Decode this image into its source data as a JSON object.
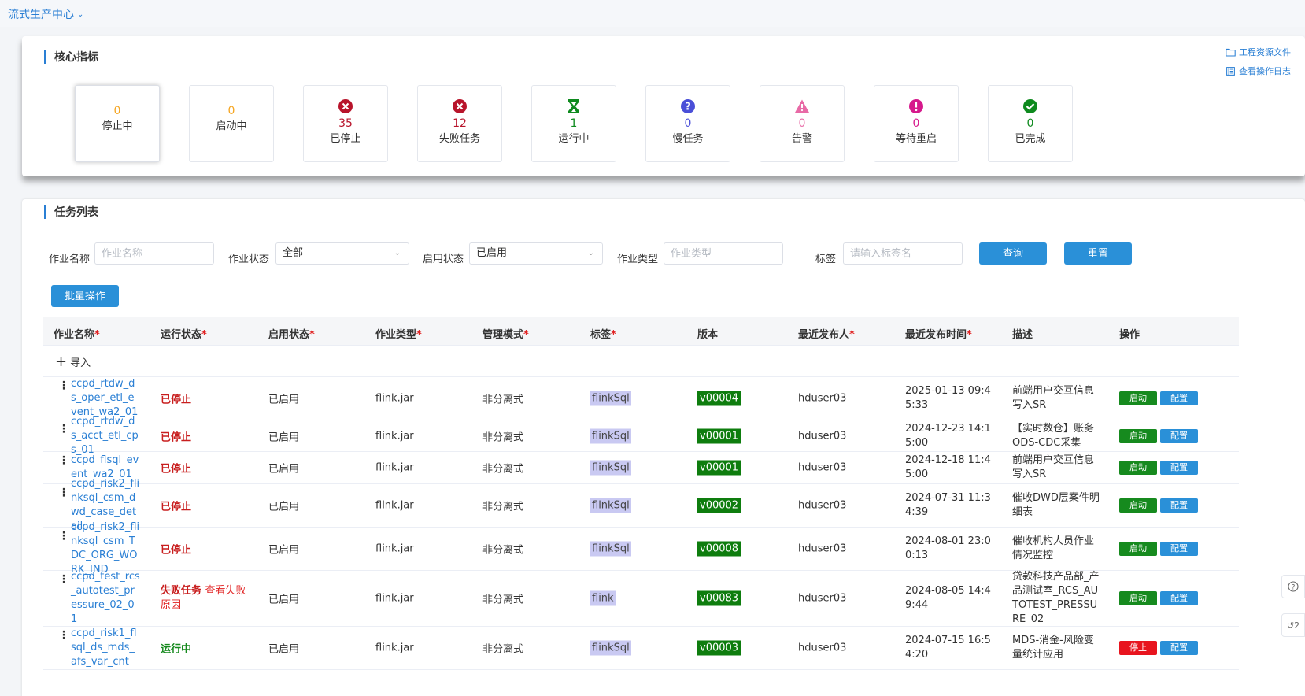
{
  "topbar": {
    "title": "流式生产中心"
  },
  "core": {
    "title": "核心指标",
    "links": [
      {
        "label": "工程资源文件",
        "icon": "folder-icon"
      },
      {
        "label": "查看操作日志",
        "icon": "log-icon"
      }
    ],
    "metrics": [
      {
        "value": "0",
        "label": "停止中",
        "color": "#f5a623",
        "icon": "none"
      },
      {
        "value": "0",
        "label": "启动中",
        "color": "#f5a623",
        "icon": "none"
      },
      {
        "value": "35",
        "label": "已停止",
        "color": "#b8142b",
        "icon": "x-circle-icon"
      },
      {
        "value": "12",
        "label": "失败任务",
        "color": "#b8142b",
        "icon": "x-circle-icon"
      },
      {
        "value": "1",
        "label": "运行中",
        "color": "#0e8a1e",
        "icon": "hourglass-icon"
      },
      {
        "value": "0",
        "label": "慢任务",
        "color": "#4a4fd8",
        "icon": "question-circle-icon"
      },
      {
        "value": "0",
        "label": "告警",
        "color": "#e86aa6",
        "icon": "warning-triangle-icon"
      },
      {
        "value": "0",
        "label": "等待重启",
        "color": "#d6198c",
        "icon": "exclamation-circle-icon"
      },
      {
        "value": "0",
        "label": "已完成",
        "color": "#0e8a1e",
        "icon": "check-circle-icon"
      }
    ]
  },
  "tasks": {
    "title": "任务列表",
    "filters": {
      "job_name_label": "作业名称",
      "job_name_placeholder": "作业名称",
      "run_status_label": "作业状态",
      "run_status_value": "全部",
      "enable_status_label": "启用状态",
      "enable_status_value": "已启用",
      "job_type_label": "作业类型",
      "job_type_placeholder": "作业类型",
      "tag_label": "标签",
      "tag_placeholder": "请输入标签名",
      "query_label": "查询",
      "reset_label": "重置"
    },
    "batch_label": "批量操作",
    "import_label": "导入",
    "columns": [
      {
        "label": "作业名称",
        "req": "*"
      },
      {
        "label": "运行状态",
        "req": "*"
      },
      {
        "label": "启用状态",
        "req": "*"
      },
      {
        "label": "作业类型",
        "req": "*"
      },
      {
        "label": "管理模式",
        "req": "*"
      },
      {
        "label": "标签",
        "req": "*"
      },
      {
        "label": "版本",
        "req": ""
      },
      {
        "label": "最近发布人",
        "req": "*"
      },
      {
        "label": "最近发布时间",
        "req": "*"
      },
      {
        "label": "描述",
        "req": ""
      },
      {
        "label": "操作",
        "req": ""
      }
    ],
    "rows": [
      {
        "name": "ccpd_rtdw_ds_oper_etl_event_wa2_01",
        "status": "已停止",
        "status_type": "stop",
        "fail_link": "",
        "enabled": "已启用",
        "type": "flink.jar",
        "mode": "非分离式",
        "tag": "flinkSql",
        "version": "v00004",
        "publisher": "hduser03",
        "time": "2025-01-13 09:45:33",
        "desc": "前端用户交互信息写入SR",
        "action": "启动",
        "action_type": "start",
        "config": "配置"
      },
      {
        "name": "ccpd_rtdw_ds_acct_etl_cps_01",
        "status": "已停止",
        "status_type": "stop",
        "fail_link": "",
        "enabled": "已启用",
        "type": "flink.jar",
        "mode": "非分离式",
        "tag": "flinkSql",
        "version": "v00001",
        "publisher": "hduser03",
        "time": "2024-12-23 14:15:00",
        "desc": "【实时数仓】账务ODS-CDC采集",
        "action": "启动",
        "action_type": "start",
        "config": "配置"
      },
      {
        "name": "ccpd_flsql_event_wa2_01",
        "status": "已停止",
        "status_type": "stop",
        "fail_link": "",
        "enabled": "已启用",
        "type": "flink.jar",
        "mode": "非分离式",
        "tag": "flinkSql",
        "version": "v00001",
        "publisher": "hduser03",
        "time": "2024-12-18 11:45:00",
        "desc": "前端用户交互信息写入SR",
        "action": "启动",
        "action_type": "start",
        "config": "配置"
      },
      {
        "name": "ccpd_risk2_flinksql_csm_dwd_case_detail",
        "status": "已停止",
        "status_type": "stop",
        "fail_link": "",
        "enabled": "已启用",
        "type": "flink.jar",
        "mode": "非分离式",
        "tag": "flinkSql",
        "version": "v00002",
        "publisher": "hduser03",
        "time": "2024-07-31 11:34:39",
        "desc": "催收DWD层案件明细表",
        "action": "启动",
        "action_type": "start",
        "config": "配置"
      },
      {
        "name": "ccpd_risk2_flinksql_csm_TDC_ORG_WORK_IND",
        "status": "已停止",
        "status_type": "stop",
        "fail_link": "",
        "enabled": "已启用",
        "type": "flink.jar",
        "mode": "非分离式",
        "tag": "flinkSql",
        "version": "v00008",
        "publisher": "hduser03",
        "time": "2024-08-01 23:00:13",
        "desc": "催收机构人员作业情况监控",
        "action": "启动",
        "action_type": "start",
        "config": "配置"
      },
      {
        "name": "ccpd_test_rcs_autotest_pressure_02_01",
        "status": "失败任务",
        "status_type": "fail",
        "fail_link": "查看失败原因",
        "enabled": "已启用",
        "type": "flink.jar",
        "mode": "非分离式",
        "tag": "flink",
        "version": "v00083",
        "publisher": "hduser03",
        "time": "2024-08-05 14:49:44",
        "desc": "贷款科技产品部_产品测试室_RCS_AUTOTEST_PRESSURE_02",
        "action": "启动",
        "action_type": "start",
        "config": "配置"
      },
      {
        "name": "ccpd_risk1_flsql_ds_mds_afs_var_cnt",
        "status": "运行中",
        "status_type": "run",
        "fail_link": "",
        "enabled": "已启用",
        "type": "flink.jar",
        "mode": "非分离式",
        "tag": "flinkSql",
        "version": "v00003",
        "publisher": "hduser03",
        "time": "2024-07-15 16:54:20",
        "desc": "MDS-消金-风险变量统计应用",
        "action": "停止",
        "action_type": "stop",
        "config": "配置"
      }
    ]
  },
  "floating": {
    "help_icon": "question-icon",
    "count_label": "2"
  }
}
